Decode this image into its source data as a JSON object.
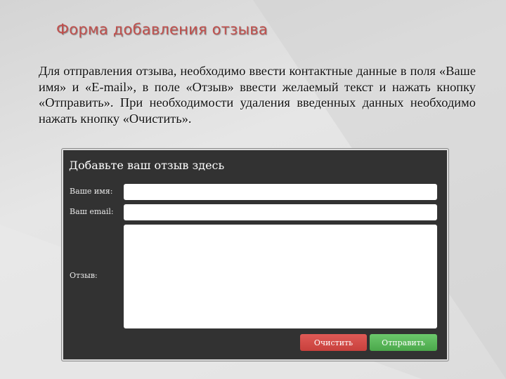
{
  "slide": {
    "title": "Форма добавления отзыва",
    "description": "Для отправления отзыва, необходимо ввести контактные данные в поля «Ваше имя» и «E-mail», в поле «Отзыв» ввести желаемый текст и нажать кнопку «Отправить». При необходимости удаления введенных данных необходимо нажать кнопку «Очистить»."
  },
  "form": {
    "header": "Добавьте ваш отзыв здесь",
    "name_label": "Ваше имя:",
    "email_label": "Ваш email:",
    "review_label": "Отзыв:",
    "clear_button": "Очистить",
    "submit_button": "Отправить"
  },
  "colors": {
    "title": "#c0504d",
    "panel_bg": "#323232",
    "clear_button": "#d14b47",
    "submit_button": "#5bb85b"
  }
}
